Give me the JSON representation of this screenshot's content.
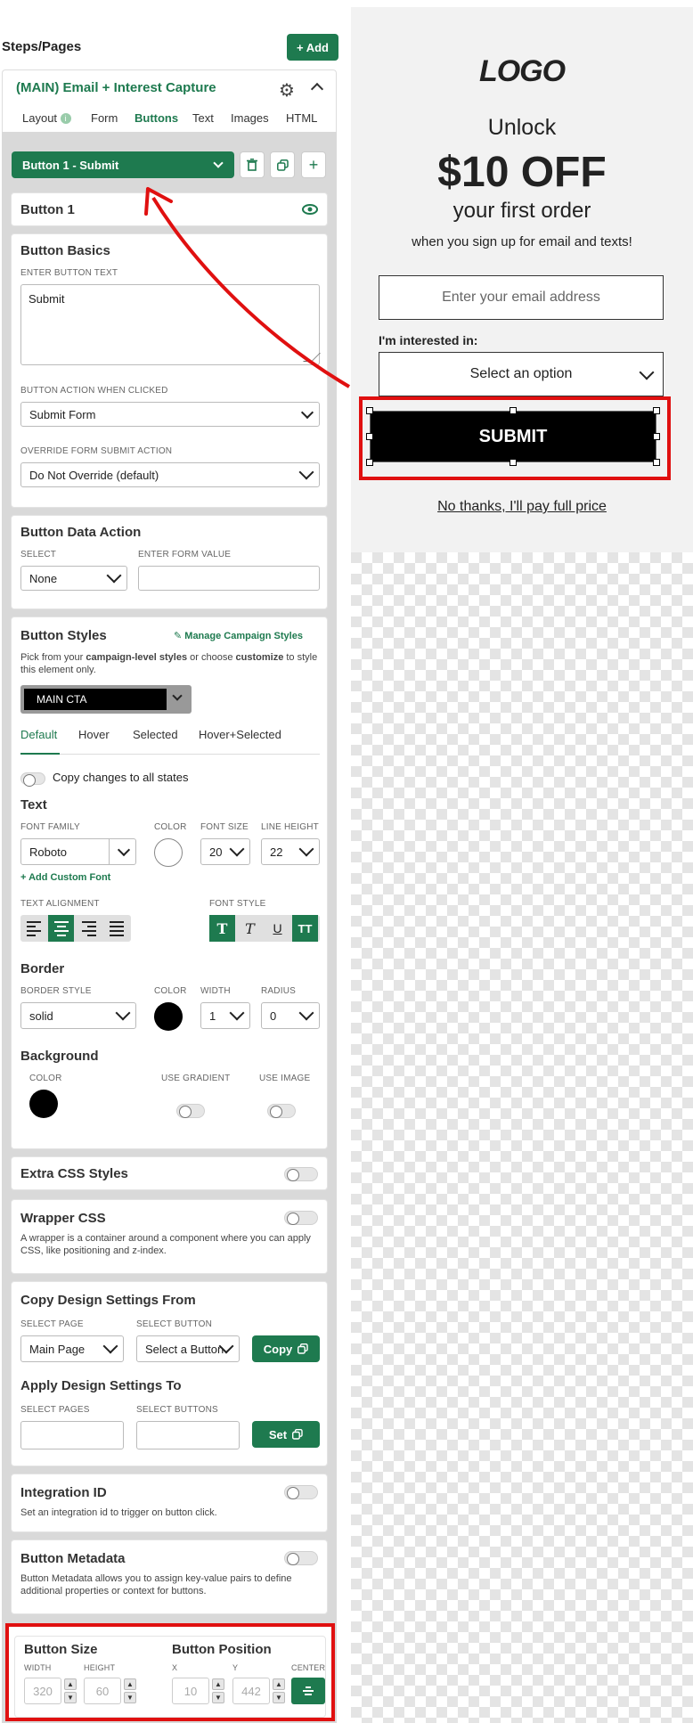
{
  "header": {
    "title": "Steps/Pages",
    "add_label": "+ Add"
  },
  "step": {
    "title": "(MAIN) Email + Interest Capture",
    "tabs": [
      {
        "label": "Layout",
        "badge": "i"
      },
      {
        "label": "Form"
      },
      {
        "label": "Buttons"
      },
      {
        "label": "Text"
      },
      {
        "label": "Images"
      },
      {
        "label": "HTML"
      }
    ],
    "active_tab": "Buttons"
  },
  "button_select": {
    "value": "Button 1 - Submit"
  },
  "button_name": "Button 1",
  "basics": {
    "title": "Button Basics",
    "text_label": "ENTER BUTTON TEXT",
    "text_value": "Submit",
    "action_label": "BUTTON ACTION WHEN CLICKED",
    "action_value": "Submit Form",
    "override_label": "OVERRIDE FORM SUBMIT ACTION",
    "override_value": "Do Not Override (default)"
  },
  "data_action": {
    "title": "Button Data Action",
    "select_label": "SELECT",
    "select_value": "None",
    "form_value_label": "ENTER FORM VALUE",
    "form_value": ""
  },
  "styles": {
    "title": "Button Styles",
    "manage_label": "Manage Campaign Styles",
    "desc_1": "Pick from your ",
    "desc_bold_1": "campaign-level styles",
    "desc_2": " or choose ",
    "desc_bold_2": "customize",
    "desc_3": " to style this element only.",
    "preset": "MAIN CTA",
    "state_tabs": [
      "Default",
      "Hover",
      "Selected",
      "Hover+Selected"
    ],
    "copy_states": "Copy changes to all states",
    "text_heading": "Text",
    "font_family_label": "FONT FAMILY",
    "font_family": "Roboto",
    "color_label": "COLOR",
    "font_size_label": "FONT SIZE",
    "font_size": "20",
    "line_height_label": "LINE HEIGHT",
    "line_height": "22",
    "add_font": "+ Add Custom Font",
    "text_align_label": "TEXT ALIGNMENT",
    "font_style_label": "FONT STYLE",
    "border_heading": "Border",
    "border_style_label": "BORDER STYLE",
    "border_style": "solid",
    "border_color_label": "COLOR",
    "width_label": "WIDTH",
    "border_width": "1",
    "radius_label": "RADIUS",
    "radius": "0",
    "background_heading": "Background",
    "bg_color_label": "COLOR",
    "gradient_label": "USE GRADIENT",
    "image_label": "USE IMAGE",
    "colors": {
      "text": "#ffffff",
      "border": "#000000",
      "background": "#000000"
    }
  },
  "extra_css": {
    "title": "Extra CSS Styles"
  },
  "wrapper": {
    "title": "Wrapper CSS",
    "desc": "A wrapper is a container around a component where you can apply CSS, like positioning and z-index."
  },
  "copy_design": {
    "title": "Copy Design Settings From",
    "page_label": "SELECT PAGE",
    "page_value": "Main Page",
    "button_label": "SELECT BUTTON",
    "button_value": "Select a Button",
    "copy_label": "Copy",
    "apply_title": "Apply Design Settings To",
    "pages_label": "SELECT PAGES",
    "buttons_label": "SELECT BUTTONS",
    "set_label": "Set"
  },
  "integration": {
    "title": "Integration ID",
    "desc": "Set an integration id to trigger on button click."
  },
  "metadata": {
    "title": "Button Metadata",
    "desc": "Button Metadata allows you to assign key-value pairs to define additional properties or context for buttons."
  },
  "size": {
    "title": "Button Size",
    "width_label": "WIDTH",
    "width": "320",
    "height_label": "HEIGHT",
    "height": "60"
  },
  "position": {
    "title": "Button Position",
    "x_label": "X",
    "x": "10",
    "y_label": "Y",
    "y": "442",
    "center_label": "CENTER"
  },
  "preview": {
    "logo": "LOGO",
    "unlock": "Unlock",
    "offer": "$10 OFF",
    "first_order": "your first order",
    "signup": "when you sign up for email and texts!",
    "email_placeholder": "Enter your email address",
    "interest_label": "I'm interested in:",
    "select_placeholder": "Select an option",
    "submit": "SUBMIT",
    "no_thanks": "No thanks, I'll pay full price"
  },
  "theme": {
    "accent": "#1e7a4f",
    "highlight": "#e01010"
  }
}
